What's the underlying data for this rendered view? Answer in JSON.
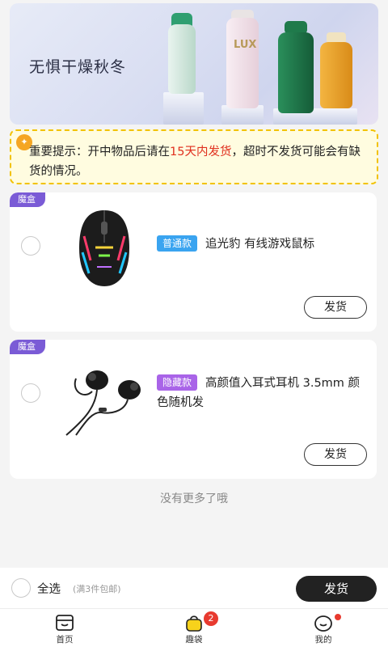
{
  "banner": {
    "title": "无惧干燥秋冬",
    "brand_text": "LUX"
  },
  "notice": {
    "prefix": "重要提示：开中物品后请在",
    "highlight": "15天内发货",
    "suffix": "，超时不发货可能会有缺货的情况。"
  },
  "items": [
    {
      "box_tag": "魔盒",
      "badge": "普通款",
      "title": "追光豹 有线游戏鼠标",
      "ship_label": "发货"
    },
    {
      "box_tag": "魔盒",
      "badge": "隐藏款",
      "title": "高颜值入耳式耳机 3.5mm 颜色随机发",
      "ship_label": "发货"
    }
  ],
  "no_more": "没有更多了哦",
  "action_bar": {
    "select_all": "全选",
    "note": "(满3件包邮)",
    "ship_all": "发货"
  },
  "tabbar": {
    "home": "首页",
    "bag": "趣袋",
    "bag_badge": "2",
    "me": "我的"
  },
  "colors": {
    "accent": "#222222",
    "badge_normal": "#3aa4f0",
    "badge_hidden": "#a964e8",
    "box_tag": "#7a5bd6",
    "notice_border": "#f2c200",
    "highlight": "#e0301e"
  }
}
